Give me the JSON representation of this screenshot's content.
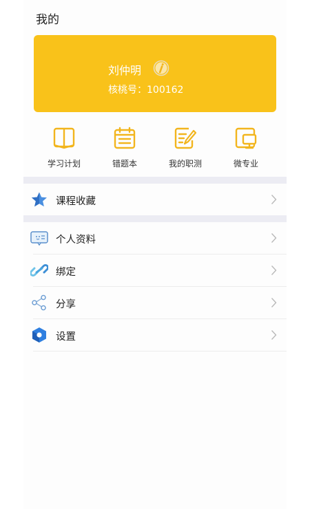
{
  "header": {
    "title": "我的"
  },
  "profile": {
    "name": "刘仲明",
    "id_text": "核桃号：100162"
  },
  "quick_actions": [
    {
      "label": "学习计划",
      "icon": "book-icon"
    },
    {
      "label": "错题本",
      "icon": "calendar-icon"
    },
    {
      "label": "我的职测",
      "icon": "edit-note-icon"
    },
    {
      "label": "微专业",
      "icon": "monitor-icon"
    }
  ],
  "menu": {
    "favorites": {
      "label": "课程收藏",
      "icon": "star-icon"
    },
    "profile": {
      "label": "个人资料",
      "icon": "id-card-icon"
    },
    "bind": {
      "label": "绑定",
      "icon": "link-icon"
    },
    "share": {
      "label": "分享",
      "icon": "share-icon"
    },
    "settings": {
      "label": "设置",
      "icon": "hexagon-settings-icon"
    }
  },
  "colors": {
    "accent": "#f9c21a",
    "band": "#ececf3",
    "icon_outline": "#f2b51d"
  }
}
